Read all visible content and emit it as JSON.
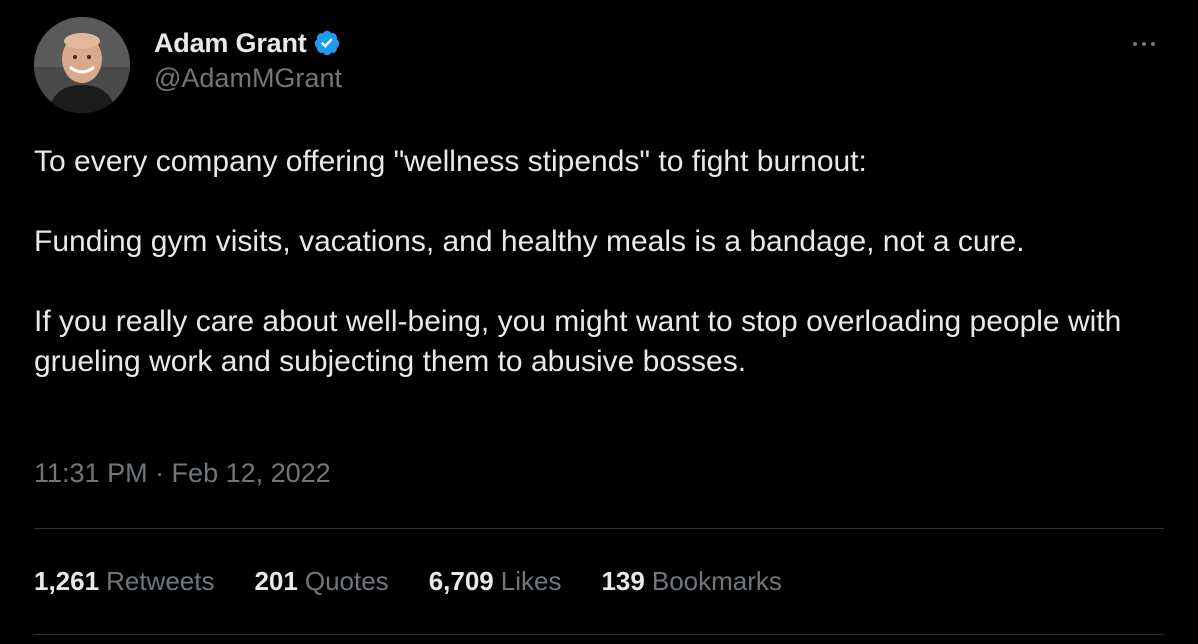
{
  "author": {
    "display_name": "Adam Grant",
    "handle": "@AdamMGrant",
    "verified_icon": "verified-badge-icon",
    "verified_color": "#1d9bf0"
  },
  "tweet": {
    "paragraphs": [
      "To every company offering \"wellness stipends\" to fight burnout:",
      "Funding gym visits, vacations, and healthy meals is a bandage, not a cure.",
      "If you really care about well-being, you might want to stop overloading people with grueling work and subjecting them to abusive bosses."
    ],
    "timestamp": "11:31 PM · Feb 12, 2022"
  },
  "stats": [
    {
      "count": "1,261",
      "label": "Retweets"
    },
    {
      "count": "201",
      "label": "Quotes"
    },
    {
      "count": "6,709",
      "label": "Likes"
    },
    {
      "count": "139",
      "label": "Bookmarks"
    }
  ],
  "colors": {
    "background": "#000000",
    "primary_text": "#e7e9ea",
    "secondary_text": "#71767b",
    "divider": "#2f3336"
  }
}
